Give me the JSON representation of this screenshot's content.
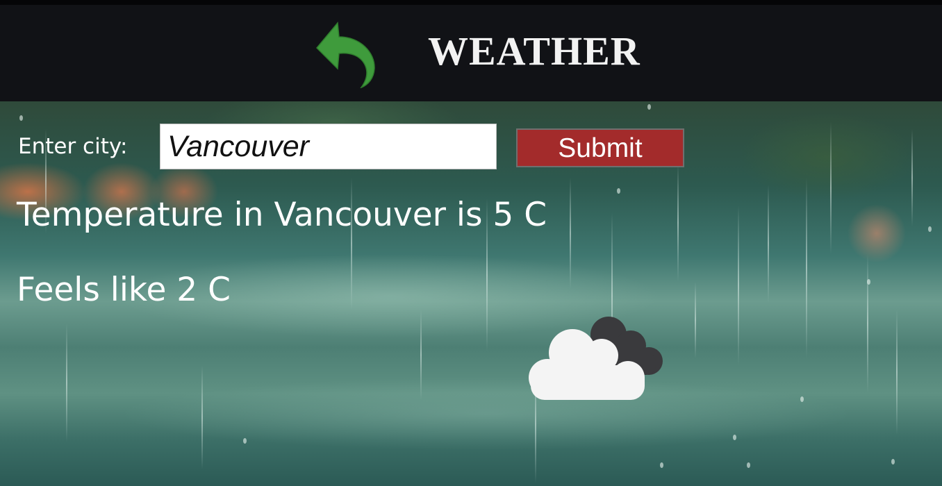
{
  "header": {
    "title": "WEATHER",
    "back_icon": "back-arrow-icon",
    "accent_color": "#3f9b3c"
  },
  "form": {
    "label": "Enter city:",
    "city_value": "Vancouver",
    "submit_label": "Submit",
    "submit_color": "#a32b2b"
  },
  "result": {
    "temperature_text": "Temperature in Vancouver is 5 C",
    "feels_like_text": "Feels like 2 C",
    "condition_icon": "cloudy-icon"
  }
}
